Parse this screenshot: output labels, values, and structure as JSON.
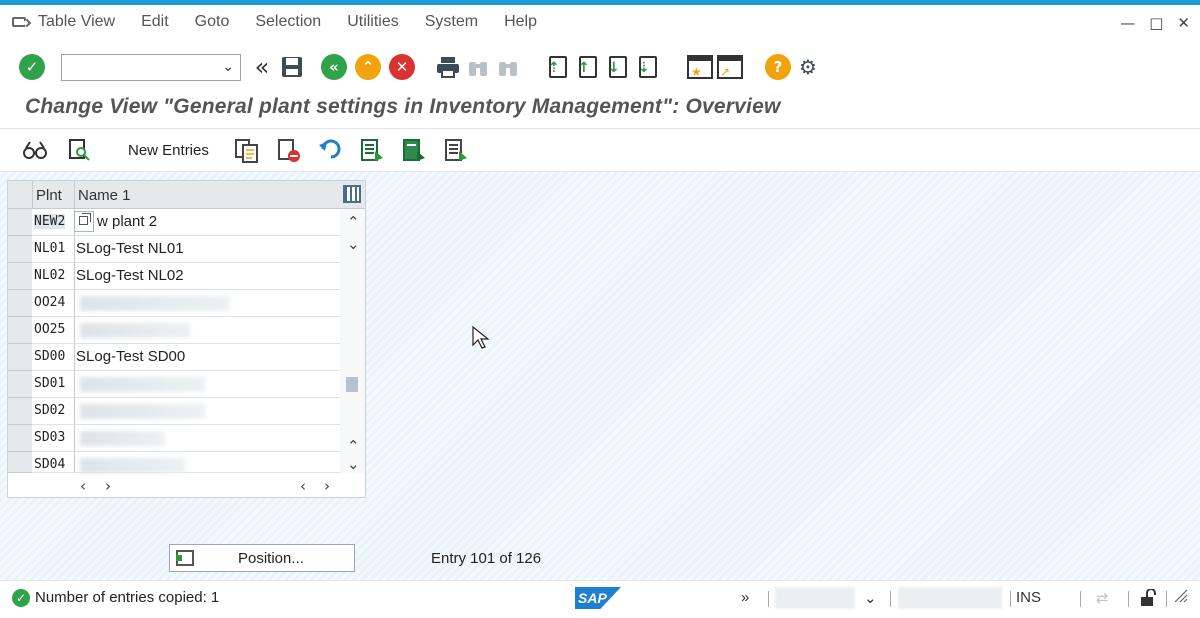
{
  "menu": {
    "items": [
      "Table View",
      "Edit",
      "Goto",
      "Selection",
      "Utilities",
      "System",
      "Help"
    ]
  },
  "window_controls": [
    "—",
    "□",
    "✕"
  ],
  "command_field": {
    "value": ""
  },
  "title": "Change View \"General plant settings in Inventory Management\": Overview",
  "toolbar2": {
    "new_entries_label": "New Entries"
  },
  "table": {
    "columns": [
      "Plnt",
      "Name 1"
    ],
    "rows": [
      {
        "plnt": "NEW2",
        "name": "w plant 2"
      },
      {
        "plnt": "NL01",
        "name": "SLog-Test NL01"
      },
      {
        "plnt": "NL02",
        "name": "SLog-Test NL02"
      },
      {
        "plnt": "OO24",
        "name": ""
      },
      {
        "plnt": "OO25",
        "name": ""
      },
      {
        "plnt": "SD00",
        "name": "SLog-Test SD00"
      },
      {
        "plnt": "SD01",
        "name": ""
      },
      {
        "plnt": "SD02",
        "name": ""
      },
      {
        "plnt": "SD03",
        "name": ""
      },
      {
        "plnt": "SD04",
        "name": ""
      }
    ]
  },
  "position_button": {
    "label": "Position..."
  },
  "entry_info": "Entry 101 of 126",
  "status": {
    "message": "Number of entries copied: 1",
    "logo": "SAP",
    "mode": "INS",
    "chevrons": "»"
  },
  "colors": {
    "accent": "#1b9ad6",
    "ok_green": "#2fa24a",
    "warn_orange": "#f0a30a",
    "cancel_red": "#d9332f"
  }
}
